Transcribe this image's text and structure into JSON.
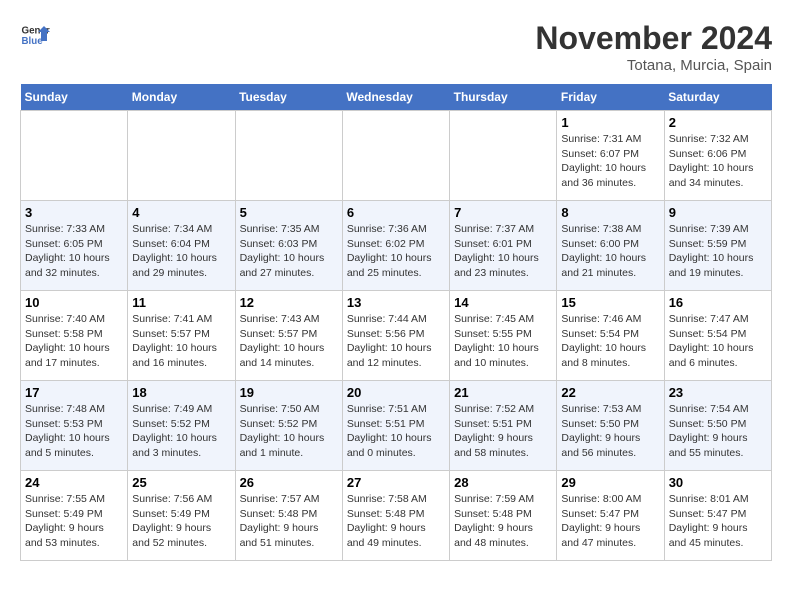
{
  "header": {
    "logo_line1": "General",
    "logo_line2": "Blue",
    "month_title": "November 2024",
    "location": "Totana, Murcia, Spain"
  },
  "weekdays": [
    "Sunday",
    "Monday",
    "Tuesday",
    "Wednesday",
    "Thursday",
    "Friday",
    "Saturday"
  ],
  "weeks": [
    [
      {
        "day": "",
        "info": ""
      },
      {
        "day": "",
        "info": ""
      },
      {
        "day": "",
        "info": ""
      },
      {
        "day": "",
        "info": ""
      },
      {
        "day": "",
        "info": ""
      },
      {
        "day": "1",
        "info": "Sunrise: 7:31 AM\nSunset: 6:07 PM\nDaylight: 10 hours\nand 36 minutes."
      },
      {
        "day": "2",
        "info": "Sunrise: 7:32 AM\nSunset: 6:06 PM\nDaylight: 10 hours\nand 34 minutes."
      }
    ],
    [
      {
        "day": "3",
        "info": "Sunrise: 7:33 AM\nSunset: 6:05 PM\nDaylight: 10 hours\nand 32 minutes."
      },
      {
        "day": "4",
        "info": "Sunrise: 7:34 AM\nSunset: 6:04 PM\nDaylight: 10 hours\nand 29 minutes."
      },
      {
        "day": "5",
        "info": "Sunrise: 7:35 AM\nSunset: 6:03 PM\nDaylight: 10 hours\nand 27 minutes."
      },
      {
        "day": "6",
        "info": "Sunrise: 7:36 AM\nSunset: 6:02 PM\nDaylight: 10 hours\nand 25 minutes."
      },
      {
        "day": "7",
        "info": "Sunrise: 7:37 AM\nSunset: 6:01 PM\nDaylight: 10 hours\nand 23 minutes."
      },
      {
        "day": "8",
        "info": "Sunrise: 7:38 AM\nSunset: 6:00 PM\nDaylight: 10 hours\nand 21 minutes."
      },
      {
        "day": "9",
        "info": "Sunrise: 7:39 AM\nSunset: 5:59 PM\nDaylight: 10 hours\nand 19 minutes."
      }
    ],
    [
      {
        "day": "10",
        "info": "Sunrise: 7:40 AM\nSunset: 5:58 PM\nDaylight: 10 hours\nand 17 minutes."
      },
      {
        "day": "11",
        "info": "Sunrise: 7:41 AM\nSunset: 5:57 PM\nDaylight: 10 hours\nand 16 minutes."
      },
      {
        "day": "12",
        "info": "Sunrise: 7:43 AM\nSunset: 5:57 PM\nDaylight: 10 hours\nand 14 minutes."
      },
      {
        "day": "13",
        "info": "Sunrise: 7:44 AM\nSunset: 5:56 PM\nDaylight: 10 hours\nand 12 minutes."
      },
      {
        "day": "14",
        "info": "Sunrise: 7:45 AM\nSunset: 5:55 PM\nDaylight: 10 hours\nand 10 minutes."
      },
      {
        "day": "15",
        "info": "Sunrise: 7:46 AM\nSunset: 5:54 PM\nDaylight: 10 hours\nand 8 minutes."
      },
      {
        "day": "16",
        "info": "Sunrise: 7:47 AM\nSunset: 5:54 PM\nDaylight: 10 hours\nand 6 minutes."
      }
    ],
    [
      {
        "day": "17",
        "info": "Sunrise: 7:48 AM\nSunset: 5:53 PM\nDaylight: 10 hours\nand 5 minutes."
      },
      {
        "day": "18",
        "info": "Sunrise: 7:49 AM\nSunset: 5:52 PM\nDaylight: 10 hours\nand 3 minutes."
      },
      {
        "day": "19",
        "info": "Sunrise: 7:50 AM\nSunset: 5:52 PM\nDaylight: 10 hours\nand 1 minute."
      },
      {
        "day": "20",
        "info": "Sunrise: 7:51 AM\nSunset: 5:51 PM\nDaylight: 10 hours\nand 0 minutes."
      },
      {
        "day": "21",
        "info": "Sunrise: 7:52 AM\nSunset: 5:51 PM\nDaylight: 9 hours\nand 58 minutes."
      },
      {
        "day": "22",
        "info": "Sunrise: 7:53 AM\nSunset: 5:50 PM\nDaylight: 9 hours\nand 56 minutes."
      },
      {
        "day": "23",
        "info": "Sunrise: 7:54 AM\nSunset: 5:50 PM\nDaylight: 9 hours\nand 55 minutes."
      }
    ],
    [
      {
        "day": "24",
        "info": "Sunrise: 7:55 AM\nSunset: 5:49 PM\nDaylight: 9 hours\nand 53 minutes."
      },
      {
        "day": "25",
        "info": "Sunrise: 7:56 AM\nSunset: 5:49 PM\nDaylight: 9 hours\nand 52 minutes."
      },
      {
        "day": "26",
        "info": "Sunrise: 7:57 AM\nSunset: 5:48 PM\nDaylight: 9 hours\nand 51 minutes."
      },
      {
        "day": "27",
        "info": "Sunrise: 7:58 AM\nSunset: 5:48 PM\nDaylight: 9 hours\nand 49 minutes."
      },
      {
        "day": "28",
        "info": "Sunrise: 7:59 AM\nSunset: 5:48 PM\nDaylight: 9 hours\nand 48 minutes."
      },
      {
        "day": "29",
        "info": "Sunrise: 8:00 AM\nSunset: 5:47 PM\nDaylight: 9 hours\nand 47 minutes."
      },
      {
        "day": "30",
        "info": "Sunrise: 8:01 AM\nSunset: 5:47 PM\nDaylight: 9 hours\nand 45 minutes."
      }
    ]
  ]
}
